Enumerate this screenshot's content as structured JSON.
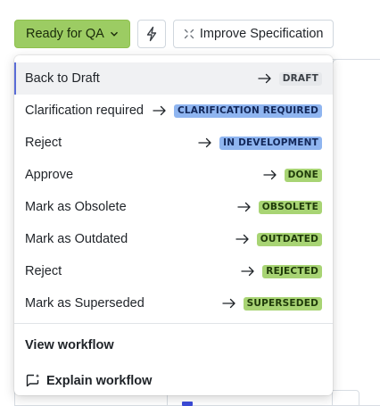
{
  "toolbar": {
    "status_label": "Ready for QA",
    "status_color": "#9ccc63",
    "automation_icon": "lightning-icon",
    "improve_label": "Improve Specification",
    "improve_icon": "sparkle-icon"
  },
  "menu": {
    "transitions": [
      {
        "label": "Back to Draft",
        "target": "DRAFT",
        "badge_bg": "#e6e8eb",
        "badge_fg": "#3a3f45",
        "active": true
      },
      {
        "label": "Clarification required",
        "target": "CLARIFICATION REQUIRED",
        "badge_bg": "#8fb5f0",
        "badge_fg": "#13285a",
        "active": false
      },
      {
        "label": "Reject",
        "target": "IN DEVELOPMENT",
        "badge_bg": "#8fb5f0",
        "badge_fg": "#13285a",
        "active": false
      },
      {
        "label": "Approve",
        "target": "DONE",
        "badge_bg": "#a8d474",
        "badge_fg": "#1f3a0a",
        "active": false
      },
      {
        "label": "Mark as Obsolete",
        "target": "OBSOLETE",
        "badge_bg": "#a8d474",
        "badge_fg": "#1f3a0a",
        "active": false
      },
      {
        "label": "Mark as Outdated",
        "target": "OUTDATED",
        "badge_bg": "#a8d474",
        "badge_fg": "#1f3a0a",
        "active": false
      },
      {
        "label": "Reject",
        "target": "REJECTED",
        "badge_bg": "#a8d474",
        "badge_fg": "#1f3a0a",
        "active": false
      },
      {
        "label": "Mark as Superseded",
        "target": "SUPERSEDED",
        "badge_bg": "#a8d474",
        "badge_fg": "#1f3a0a",
        "active": false
      }
    ],
    "view_workflow_label": "View workflow",
    "explain_workflow_label": "Explain workflow",
    "explain_icon": "chat-sparkle-icon"
  }
}
